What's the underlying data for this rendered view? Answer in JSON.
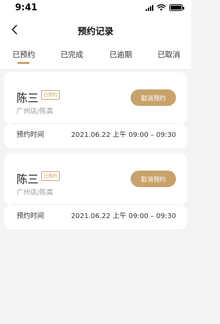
{
  "status": {
    "time": "9:41"
  },
  "nav": {
    "title": "预约记录"
  },
  "tabs": [
    {
      "label": "已预约",
      "active": true
    },
    {
      "label": "已完成",
      "active": false
    },
    {
      "label": "已逾期",
      "active": false
    },
    {
      "label": "已取消",
      "active": false
    }
  ],
  "cards": [
    {
      "name": "陈三",
      "badge": "已预约",
      "store": "广州店/陈真",
      "button": "取消预约",
      "time_label": "预约时间",
      "time_value": "2021.06.22  上午 09:00 – 09:30"
    },
    {
      "name": "陈三",
      "badge": "已预约",
      "store": "广州店/陈真",
      "button": "取消预约",
      "time_label": "预约时间",
      "time_value": "2021.06.22  上午 09:00 – 09:30"
    }
  ],
  "colors": {
    "accent": "#c8a26a",
    "background": "#f4f4f4",
    "card": "#ffffff"
  }
}
